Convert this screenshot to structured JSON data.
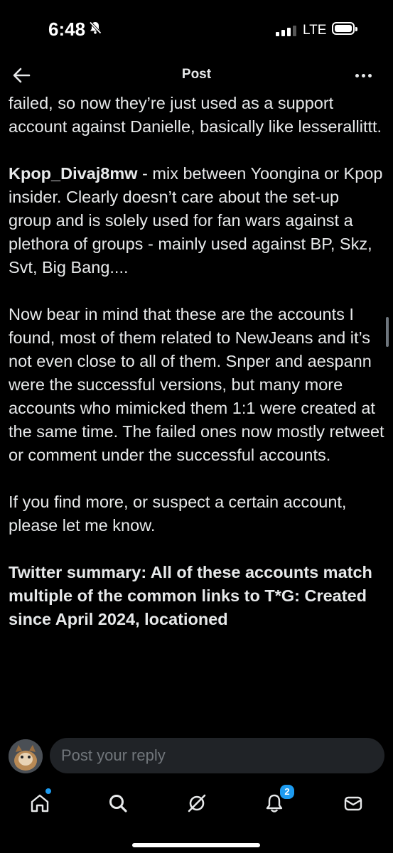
{
  "status_bar": {
    "time": "6:48",
    "network": "LTE"
  },
  "header": {
    "title": "Post"
  },
  "post": {
    "paragraph1": "failed, so now they’re just used as a support account against Danielle, basically like lesserallittt.",
    "p2_handle": "Kpop_Divaj8mw",
    "p2_text": " - mix between Yoongina or Kpop insider. Clearly doesn’t care about the set-up group and is solely used for fan wars against a plethora of groups - mainly used against BP, Skz, Svt, Big Bang....",
    "paragraph3": "Now bear in mind that these are the accounts I found, most of them related  to NewJeans and it’s not even close to all of them. Snper and aespann were the successful versions, but many more accounts who mimicked them 1:1 were created at the same time. The failed ones now mostly retweet or comment under the successful accounts.",
    "paragraph4": "If you find more, or suspect a certain account, please let me know.",
    "paragraph5": "Twitter summary: All of these accounts match multiple of the common links to T*G: Created since April 2024, locationed"
  },
  "reply": {
    "placeholder": "Post your reply"
  },
  "tabbar": {
    "items": [
      "home",
      "search",
      "grok",
      "notifications",
      "messages"
    ],
    "notifications_badge": "2"
  },
  "colors": {
    "background": "#000000",
    "text": "#e7e9ea",
    "accent": "#1d9bf0",
    "input_bg": "#202327"
  }
}
